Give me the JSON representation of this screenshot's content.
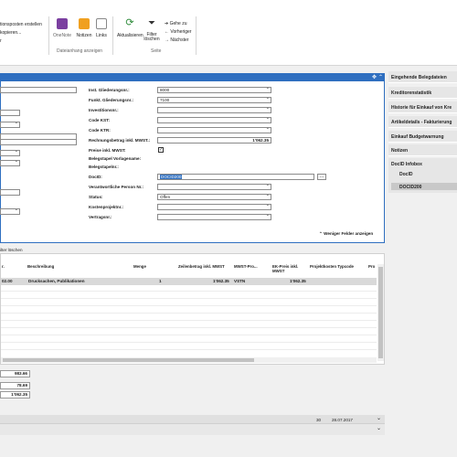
{
  "ribbon": {
    "left_text_1": "tionsposten erstellen",
    "left_text_2": "kopieren...",
    "left_text_3": "r",
    "onenote_label": "OneNote",
    "notizen_label": "Notizen",
    "links_label": "Links",
    "group_dateianhang": "Dateianhang anzeigen",
    "aktualisieren_label": "Aktualisieren",
    "filter_label": "Filter löschen",
    "gehe_zu_label": "Gehe zu",
    "vorheriger_label": "Vorheriger",
    "naechster_label": "Nächster",
    "group_seite": "Seite"
  },
  "form": {
    "fields_right": [
      {
        "label": "Inst. Gliederungsnr.:",
        "value": "8000"
      },
      {
        "label": "Funkt. Gliederungsnr.:",
        "value": "7100"
      },
      {
        "label": "Investitionsnr.:",
        "value": ""
      },
      {
        "label": "Code KST:",
        "value": ""
      },
      {
        "label": "Code KTR:",
        "value": ""
      },
      {
        "label": "Rechnungsbetrag inkl. MWST.:",
        "value": "1'062.35"
      },
      {
        "label": "Preise inkl. MWST:",
        "value": "✓"
      },
      {
        "label": "Belegstapel Vorlagename:",
        "value": ""
      },
      {
        "label": "Belegstapelnr.:",
        "value": ""
      },
      {
        "label": "DocID:",
        "value": "DOCID200"
      },
      {
        "label": "Verantwortliche Person Nr.:",
        "value": ""
      },
      {
        "label": "Status:",
        "value": "Offen"
      },
      {
        "label": "Kostenprojektnr.:",
        "value": ""
      },
      {
        "label": "Vertragsnr.:",
        "value": ""
      }
    ],
    "fewer_fields_label": "Weniger Felder anzeigen"
  },
  "factbox": {
    "items": [
      "Eingehende Belegdateien",
      "Kreditorenstatistik",
      "Historie für Einkauf von Kre",
      "Artikeldetails - Fakturierung",
      "Einkauf Budgetwarnung",
      "Notizen",
      "DocID Infobox"
    ],
    "docid_label": "DocID",
    "docid_value": "DOCID200"
  },
  "lines": {
    "filter_text": "ilter löschen",
    "headers": [
      "r.",
      "Beschreibung",
      "Menge",
      "Zeilenbetrag inkl. MWST",
      "MWST-Pro...",
      "EK-Preis inkl. MWST",
      "Projektkosten Typcode",
      "Pro"
    ],
    "rows": [
      {
        "nr": "02.00",
        "desc": "Drucksachen, Publikationen",
        "qty": "1",
        "amount": "1'062.35",
        "vat": "VSTN",
        "price": "1'062.35"
      }
    ]
  },
  "totals": [
    "983.66",
    "78.69",
    "1'062.35"
  ],
  "status": {
    "page_no": "30",
    "date": "28.07.2017"
  },
  "colors": {
    "accent": "#2f6fc0",
    "selected_row": "#d9d9d9"
  }
}
